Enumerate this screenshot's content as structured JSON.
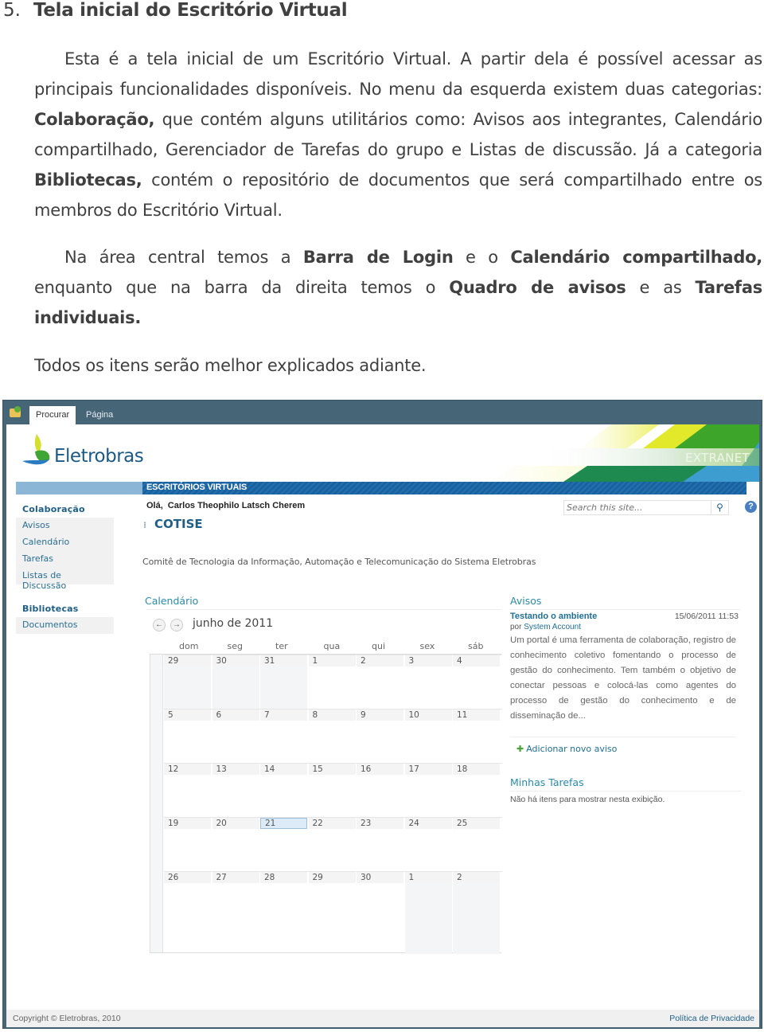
{
  "document": {
    "section_number": "5.",
    "section_title": "Tela inicial do Escritório Virtual",
    "paragraph1": {
      "t1": "Esta é a tela inicial de um Escritório Virtual. A partir dela é possível acessar as principais funcionalidades disponíveis. No menu da esquerda existem duas categorias: ",
      "b1": "Colaboração,",
      "t2": " que contém alguns utilitários como: Avisos aos integrantes, Calendário compartilhado, Gerenciador de Tarefas do grupo e Listas de discussão. Já a categoria ",
      "b2": "Bibliotecas,",
      "t3": " contém o repositório de documentos que será compartilhado entre os membros do Escritório Virtual."
    },
    "paragraph2": {
      "t1": "Na área central temos a ",
      "b1": "Barra de Login",
      "t2": " e o ",
      "b2": "Calendário compartilhado,",
      "t3": " enquanto que na barra da direita temos o ",
      "b3": "Quadro de avisos",
      "t4": " e as ",
      "b4": "Tarefas individuais."
    },
    "paragraph3": "Todos os itens serão melhor explicados adiante."
  },
  "screenshot": {
    "ribbon_tabs": [
      "Procurar",
      "Página"
    ],
    "logo_text": "Eletrobras",
    "banner_label": "EXTRANET",
    "bar_label": "ESCRITÓRIOS VIRTUAIS",
    "greeting": "Olá,",
    "user_name": "Carlos Theophilo Latsch Cherem",
    "site_title": "COTISE",
    "search_placeholder": "Search this site...",
    "help_label": "?",
    "site_description": "Comitê de Tecnologia da Informação, Automação e Telecomunicação do Sistema Eletrobras",
    "nav": {
      "group1_title": "Colaboração",
      "group1_items": [
        "Avisos",
        "Calendário",
        "Tarefas",
        "Listas de Discussão"
      ],
      "group2_title": "Bibliotecas",
      "group2_items": [
        "Documentos"
      ]
    },
    "calendar": {
      "title": "Calendário",
      "month": "junho de 2011",
      "weekdays": [
        "dom",
        "seg",
        "ter",
        "qua",
        "qui",
        "sex",
        "sáb"
      ],
      "weeks": [
        [
          "29",
          "30",
          "31",
          "1",
          "2",
          "3",
          "4"
        ],
        [
          "5",
          "6",
          "7",
          "8",
          "9",
          "10",
          "11"
        ],
        [
          "12",
          "13",
          "14",
          "15",
          "16",
          "17",
          "18"
        ],
        [
          "19",
          "20",
          "21",
          "22",
          "23",
          "24",
          "25"
        ],
        [
          "26",
          "27",
          "28",
          "29",
          "30",
          "1",
          "2"
        ]
      ],
      "today": "21"
    },
    "avisos": {
      "title": "Avisos",
      "item_title": "Testando o ambiente",
      "item_date": "15/06/2011 11:53",
      "by_prefix": "por",
      "by_author": "System Account",
      "body": "Um portal é uma ferramenta de colaboração, registro de conhecimento coletivo fomentando o processo de gestão do conhecimento. Tem também o objetivo de conectar pessoas e colocá-las como agentes do processo de gestão do conhecimento e de disseminação de...",
      "add_label": "Adicionar novo aviso"
    },
    "tasks": {
      "title": "Minhas Tarefas",
      "empty": "Não há itens para mostrar nesta exibição."
    },
    "footer": {
      "copyright": "Copyright © Eletrobras, 2010",
      "privacy": "Política de Privacidade"
    },
    "colors": {
      "ribbon": "#466677",
      "nav_link": "#2a6f94",
      "section_title": "#2a8aa8",
      "bar_blue": "#1a61a0"
    }
  }
}
